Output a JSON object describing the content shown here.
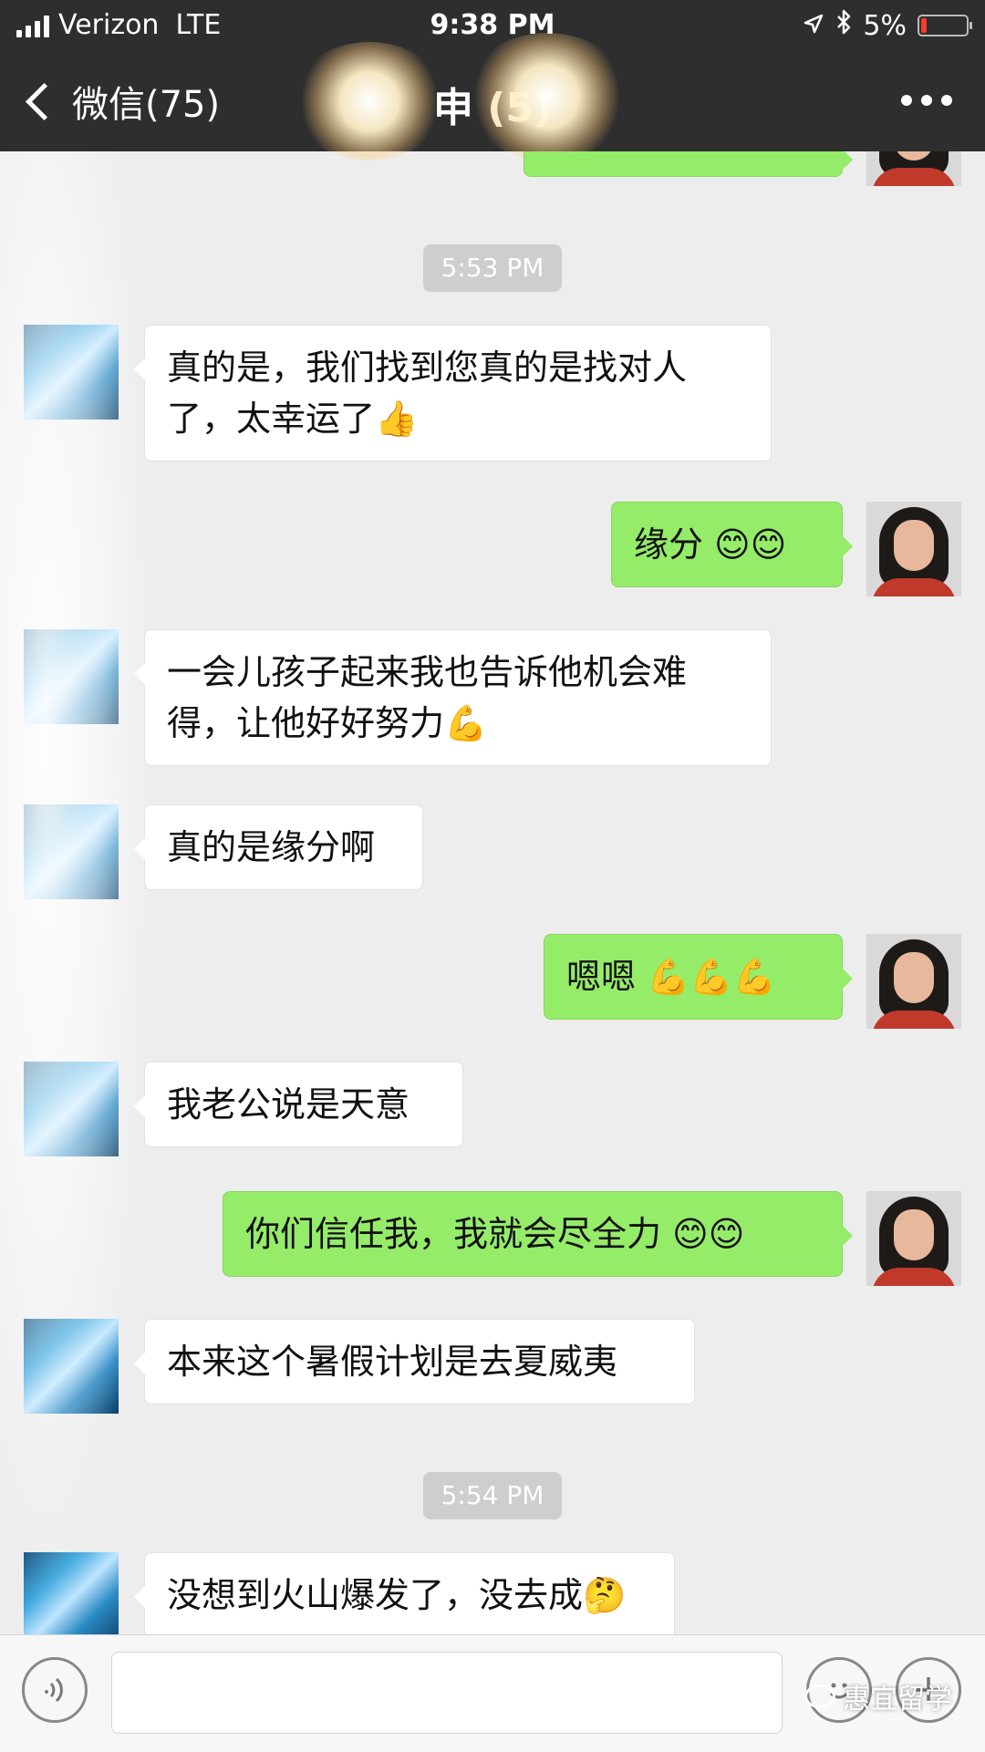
{
  "status": {
    "carrier": "Verizon",
    "network": "LTE",
    "time": "9:38 PM",
    "battery": "5%"
  },
  "nav": {
    "back_label": "微信(75)",
    "title": "申 (5)"
  },
  "chat": {
    "timestamps": [
      "5:53 PM",
      "5:54 PM"
    ],
    "messages": [
      {
        "from": "other",
        "text": "真的是，我们找到您真的是找对人了，太幸运了👍"
      },
      {
        "from": "me",
        "text": "缘分 😊😊"
      },
      {
        "from": "other",
        "text": "一会儿孩子起来我也告诉他机会难得，让他好好努力💪"
      },
      {
        "from": "other",
        "text": "真的是缘分啊"
      },
      {
        "from": "me",
        "text": "嗯嗯 💪💪💪"
      },
      {
        "from": "other",
        "text": "我老公说是天意"
      },
      {
        "from": "me",
        "text": "你们信任我，我就会尽全力 😊😊"
      },
      {
        "from": "other",
        "text": "本来这个暑假计划是去夏威夷"
      },
      {
        "from": "other",
        "text": "没想到火山爆发了，没去成🤔"
      }
    ]
  },
  "watermark": "惠宜留学",
  "colors": {
    "outgoing_bubble": "#95EC69",
    "incoming_bubble": "#FFFFFF",
    "header": "#2E2E2E",
    "chat_bg": "#EDEDED"
  },
  "icons": [
    "back-chevron-icon",
    "more-icon",
    "voice-icon",
    "emoji-icon",
    "plus-icon",
    "location-icon",
    "bluetooth-icon"
  ]
}
